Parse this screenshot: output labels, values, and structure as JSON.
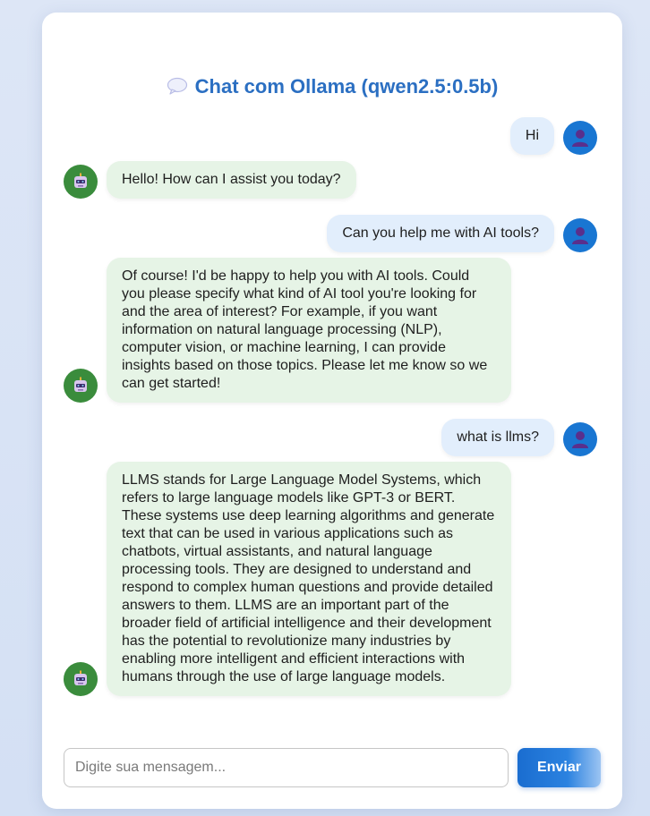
{
  "header": {
    "title": "Chat com Ollama (qwen2.5:0.5b)",
    "icon": "speech-balloon-icon"
  },
  "messages": [
    {
      "role": "user",
      "text": "Hi"
    },
    {
      "role": "bot",
      "text": "Hello! How can I assist you today?"
    },
    {
      "role": "user",
      "text": "Can you help me with AI tools?"
    },
    {
      "role": "bot",
      "text": "Of course! I'd be happy to help you with AI tools. Could you please specify what kind of AI tool you're looking for and the area of interest? For example, if you want information on natural language processing (NLP), computer vision, or machine learning, I can provide insights based on those topics. Please let me know so we can get started!"
    },
    {
      "role": "user",
      "text": "what is llms?"
    },
    {
      "role": "bot",
      "text": "LLMS stands for Large Language Model Systems, which refers to large language models like GPT-3 or BERT. These systems use deep learning algorithms and generate text that can be used in various applications such as chatbots, virtual assistants, and natural language processing tools. They are designed to understand and respond to complex human questions and provide detailed answers to them. LLMS are an important part of the broader field of artificial intelligence and their development has the potential to revolutionize many industries by enabling more intelligent and efficient interactions with humans through the use of large language models."
    }
  ],
  "composer": {
    "placeholder": "Digite sua mensagem...",
    "value": "",
    "send_label": "Enviar"
  },
  "colors": {
    "accent": "#2b6fc2",
    "user_bubble": "#e2eefc",
    "bot_bubble": "#e6f4e6",
    "user_avatar": "#1976d2",
    "bot_avatar": "#3a8c3c"
  }
}
